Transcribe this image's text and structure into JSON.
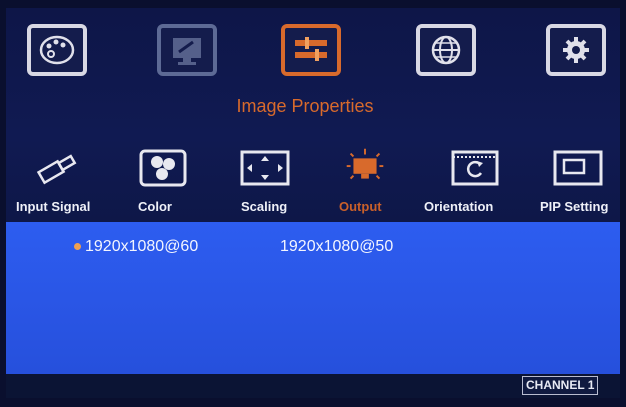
{
  "top_menu": {
    "items": [
      {
        "icon": "palette-icon",
        "state": "normal"
      },
      {
        "icon": "monitor-tools-icon",
        "state": "dim"
      },
      {
        "icon": "image-properties-icon",
        "state": "active"
      },
      {
        "icon": "globe-icon",
        "state": "normal"
      },
      {
        "icon": "gear-icon",
        "state": "normal"
      }
    ],
    "active_title": "Image Properties"
  },
  "sub_menu": {
    "items": [
      {
        "label": "Input Signal",
        "icon": "usb-plug-icon"
      },
      {
        "label": "Color",
        "icon": "color-circles-icon"
      },
      {
        "label": "Scaling",
        "icon": "scaling-arrows-icon"
      },
      {
        "label": "Output",
        "icon": "output-monitor-icon",
        "active": true
      },
      {
        "label": "Orientation",
        "icon": "rotate-icon"
      },
      {
        "label": "PIP Setting",
        "icon": "pip-window-icon"
      }
    ]
  },
  "output_options": [
    {
      "label": "1920x1080@60",
      "selected": true
    },
    {
      "label": "1920x1080@50",
      "selected": false
    }
  ],
  "status": {
    "channel": "CHANNEL 1"
  },
  "colors": {
    "accent": "#d86a2c",
    "panel": "#101a52",
    "options_bg": "#2a56e6"
  }
}
